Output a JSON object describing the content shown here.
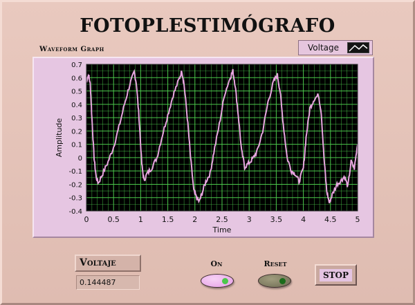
{
  "title": "FOTOPLESTIMÓGRAFO",
  "graph": {
    "label": "Waveform Graph",
    "legend_label": "Voltage"
  },
  "voltaje": {
    "label": "Voltaje",
    "value": "0.144487"
  },
  "buttons": {
    "on_label": "On",
    "reset_label": "Reset",
    "stop_label": "STOP"
  },
  "colors": {
    "panel_bg": "#e8c8be",
    "plot_bg": "#000000",
    "grid": "#4bc84b",
    "trace": "#e8a6e0",
    "frame": "#e6c6e2",
    "on_button": "#e69ee6",
    "on_led": "#4cc84c",
    "reset_button": "#6e6b52",
    "reset_led": "#1a6b1a"
  },
  "chart_data": {
    "type": "line",
    "xlabel": "Time",
    "ylabel": "Amplitude",
    "xlim": [
      0,
      5
    ],
    "ylim": [
      -0.4,
      0.7
    ],
    "x_ticks": [
      "0",
      "0.5",
      "1",
      "1.5",
      "2",
      "2.5",
      "3",
      "3.5",
      "4",
      "4.5",
      "5"
    ],
    "y_ticks": [
      "0.7",
      "0.6",
      "0.5",
      "0.4",
      "0.3",
      "0.2",
      "0.1",
      "0",
      "-0.1",
      "-0.2",
      "-0.3",
      "-0.4"
    ],
    "grid": true,
    "series": [
      {
        "points": [
          [
            0.0,
            0.58
          ],
          [
            0.04,
            0.62
          ],
          [
            0.07,
            0.55
          ],
          [
            0.1,
            0.3
          ],
          [
            0.14,
            0.0
          ],
          [
            0.18,
            -0.15
          ],
          [
            0.22,
            -0.19
          ],
          [
            0.3,
            -0.12
          ],
          [
            0.4,
            -0.03
          ],
          [
            0.5,
            0.08
          ],
          [
            0.6,
            0.23
          ],
          [
            0.7,
            0.4
          ],
          [
            0.8,
            0.55
          ],
          [
            0.88,
            0.64
          ],
          [
            0.92,
            0.56
          ],
          [
            0.97,
            0.3
          ],
          [
            1.02,
            -0.05
          ],
          [
            1.06,
            -0.17
          ],
          [
            1.12,
            -0.12
          ],
          [
            1.2,
            -0.08
          ],
          [
            1.3,
            0.0
          ],
          [
            1.4,
            0.17
          ],
          [
            1.5,
            0.32
          ],
          [
            1.6,
            0.47
          ],
          [
            1.7,
            0.58
          ],
          [
            1.76,
            0.65
          ],
          [
            1.8,
            0.55
          ],
          [
            1.86,
            0.3
          ],
          [
            1.92,
            0.0
          ],
          [
            1.98,
            -0.25
          ],
          [
            2.03,
            -0.3
          ],
          [
            2.08,
            -0.33
          ],
          [
            2.13,
            -0.27
          ],
          [
            2.2,
            -0.18
          ],
          [
            2.28,
            -0.12
          ],
          [
            2.35,
            0.04
          ],
          [
            2.45,
            0.25
          ],
          [
            2.55,
            0.48
          ],
          [
            2.65,
            0.6
          ],
          [
            2.7,
            0.65
          ],
          [
            2.74,
            0.55
          ],
          [
            2.8,
            0.32
          ],
          [
            2.86,
            0.05
          ],
          [
            2.92,
            -0.07
          ],
          [
            3.0,
            -0.04
          ],
          [
            3.08,
            0.0
          ],
          [
            3.15,
            0.05
          ],
          [
            3.25,
            0.2
          ],
          [
            3.35,
            0.42
          ],
          [
            3.45,
            0.57
          ],
          [
            3.52,
            0.62
          ],
          [
            3.57,
            0.5
          ],
          [
            3.63,
            0.25
          ],
          [
            3.7,
            0.0
          ],
          [
            3.78,
            -0.1
          ],
          [
            3.85,
            -0.12
          ],
          [
            3.92,
            -0.18
          ],
          [
            4.0,
            -0.08
          ],
          [
            4.05,
            0.15
          ],
          [
            4.12,
            0.37
          ],
          [
            4.2,
            0.44
          ],
          [
            4.28,
            0.47
          ],
          [
            4.33,
            0.34
          ],
          [
            4.38,
            0.0
          ],
          [
            4.43,
            -0.25
          ],
          [
            4.48,
            -0.34
          ],
          [
            4.53,
            -0.28
          ],
          [
            4.62,
            -0.2
          ],
          [
            4.7,
            -0.17
          ],
          [
            4.76,
            -0.14
          ],
          [
            4.82,
            -0.22
          ],
          [
            4.88,
            -0.03
          ],
          [
            4.94,
            -0.08
          ],
          [
            5.0,
            0.1
          ]
        ]
      }
    ]
  }
}
